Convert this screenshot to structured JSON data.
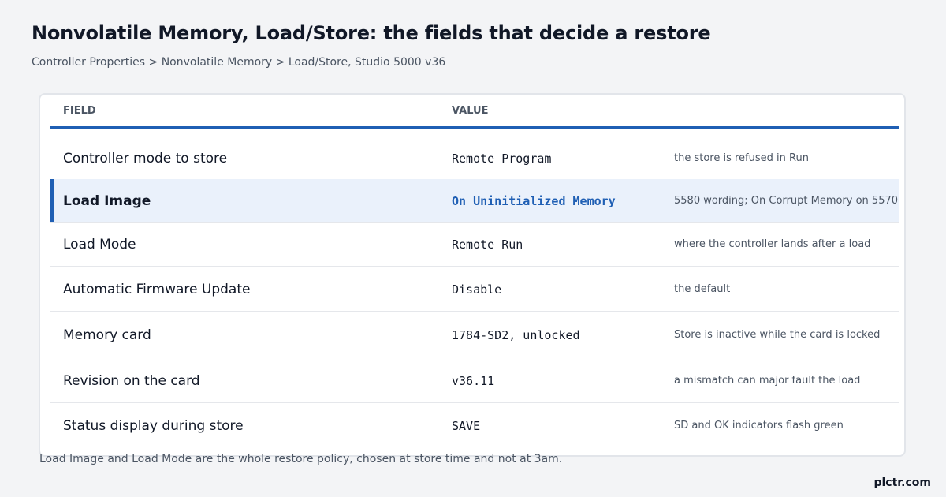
{
  "header": {
    "title": "Nonvolatile Memory, Load/Store: the fields that decide a restore",
    "breadcrumb": "Controller Properties > Nonvolatile Memory > Load/Store, Studio 5000 v36"
  },
  "table": {
    "columns": {
      "field": "FIELD",
      "value": "VALUE"
    },
    "rows": [
      {
        "field": "Controller mode to store",
        "value": "Remote Program",
        "note": "the store is refused in Run"
      },
      {
        "field": "Load Image",
        "value": "On Uninitialized Memory",
        "note": "5580 wording; On Corrupt Memory on 5570",
        "highlighted": true
      },
      {
        "field": "Load Mode",
        "value": "Remote Run",
        "note": "where the controller lands after a load"
      },
      {
        "field": "Automatic Firmware Update",
        "value": "Disable",
        "note": "the default"
      },
      {
        "field": "Memory card",
        "value": "1784-SD2, unlocked",
        "note": "Store is inactive while the card is locked"
      },
      {
        "field": "Revision on the card",
        "value": "v36.11",
        "note": "a mismatch can major fault the load"
      },
      {
        "field": "Status display during store",
        "value": "SAVE",
        "note": "SD and OK indicators flash green"
      }
    ]
  },
  "footnote": "Load Image and Load Mode are the whole restore policy, chosen at store time and not at 3am.",
  "brand": "plctr.com",
  "colors": {
    "accent": "#1f5fb4",
    "highlight_row": "#eaf1fb",
    "background": "#f3f4f6"
  }
}
